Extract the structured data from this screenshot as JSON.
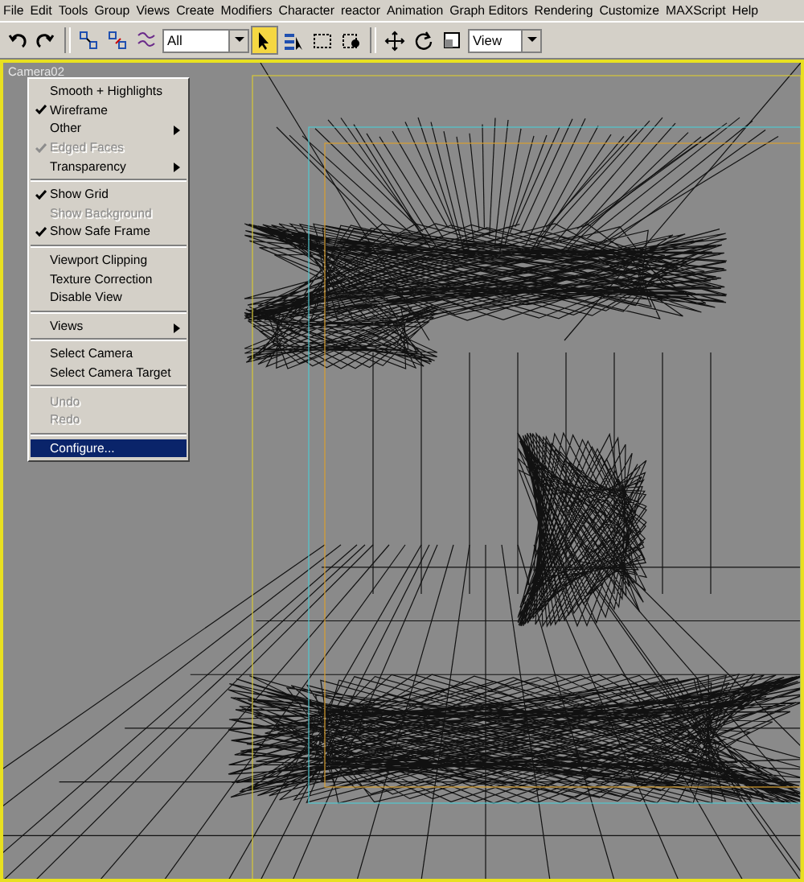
{
  "menu_bar": [
    "File",
    "Edit",
    "Tools",
    "Group",
    "Views",
    "Create",
    "Modifiers",
    "Character",
    "reactor",
    "Animation",
    "Graph Editors",
    "Rendering",
    "Customize",
    "MAXScript",
    "Help"
  ],
  "toolbar": {
    "tools": [
      {
        "selected": false
      },
      {
        "selected": false
      },
      {
        "selected": false
      },
      {
        "selected": false
      },
      {
        "selected": false
      },
      {
        "selected": true
      },
      {
        "selected": false
      },
      {
        "selected": false
      },
      {
        "selected": false
      },
      {
        "selected": false
      },
      {
        "selected": false
      },
      {
        "selected": false
      }
    ],
    "selection_filter": "All",
    "reference_coordinate": "View"
  },
  "viewport": {
    "label": "Camera02",
    "active": true
  },
  "context_menu": [
    [
      {
        "label": "Smooth + Highlights",
        "checked": false,
        "disabled": false,
        "submenu": false,
        "selected": false
      },
      {
        "label": "Wireframe",
        "checked": true,
        "disabled": false,
        "submenu": false,
        "selected": false
      },
      {
        "label": "Other",
        "checked": false,
        "disabled": false,
        "submenu": true,
        "selected": false
      },
      {
        "label": "Edged Faces",
        "checked": true,
        "disabled": true,
        "submenu": false,
        "selected": false
      },
      {
        "label": "Transparency",
        "checked": false,
        "disabled": false,
        "submenu": true,
        "selected": false
      }
    ],
    [
      {
        "label": "Show Grid",
        "checked": true,
        "disabled": false,
        "submenu": false,
        "selected": false
      },
      {
        "label": "Show Background",
        "checked": false,
        "disabled": true,
        "submenu": false,
        "selected": false
      },
      {
        "label": "Show Safe Frame",
        "checked": true,
        "disabled": false,
        "submenu": false,
        "selected": false
      }
    ],
    [
      {
        "label": "Viewport Clipping",
        "checked": false,
        "disabled": false,
        "submenu": false,
        "selected": false
      },
      {
        "label": "Texture Correction",
        "checked": false,
        "disabled": false,
        "submenu": false,
        "selected": false
      },
      {
        "label": "Disable View",
        "checked": false,
        "disabled": false,
        "submenu": false,
        "selected": false
      }
    ],
    [
      {
        "label": "Views",
        "checked": false,
        "disabled": false,
        "submenu": true,
        "selected": false
      }
    ],
    [
      {
        "label": "Select Camera",
        "checked": false,
        "disabled": false,
        "submenu": false,
        "selected": false
      },
      {
        "label": "Select Camera Target",
        "checked": false,
        "disabled": false,
        "submenu": false,
        "selected": false
      }
    ],
    [
      {
        "label": "Undo",
        "checked": false,
        "disabled": true,
        "submenu": false,
        "selected": false
      },
      {
        "label": "Redo",
        "checked": false,
        "disabled": true,
        "submenu": false,
        "selected": false
      }
    ],
    [
      {
        "label": "Configure...",
        "checked": false,
        "disabled": false,
        "submenu": false,
        "selected": true
      }
    ]
  ]
}
